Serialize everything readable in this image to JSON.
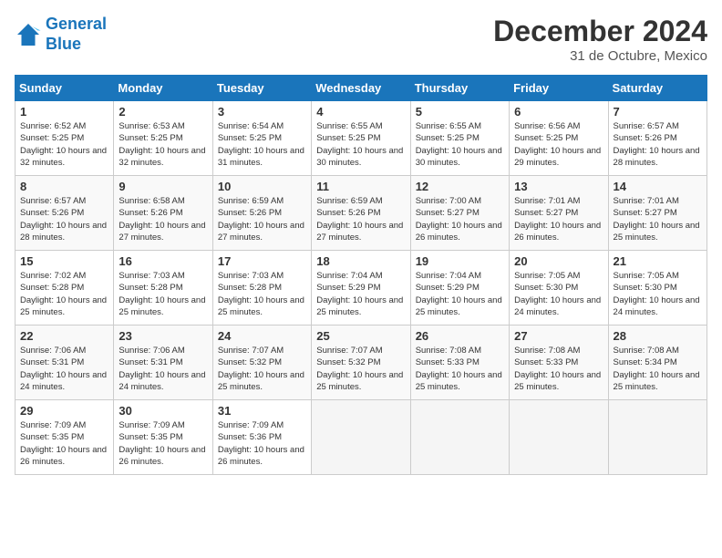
{
  "header": {
    "logo_line1": "General",
    "logo_line2": "Blue",
    "month": "December 2024",
    "location": "31 de Octubre, Mexico"
  },
  "days_of_week": [
    "Sunday",
    "Monday",
    "Tuesday",
    "Wednesday",
    "Thursday",
    "Friday",
    "Saturday"
  ],
  "weeks": [
    [
      {
        "date": "1",
        "sunrise": "6:52 AM",
        "sunset": "5:25 PM",
        "daylight": "10 hours and 32 minutes."
      },
      {
        "date": "2",
        "sunrise": "6:53 AM",
        "sunset": "5:25 PM",
        "daylight": "10 hours and 32 minutes."
      },
      {
        "date": "3",
        "sunrise": "6:54 AM",
        "sunset": "5:25 PM",
        "daylight": "10 hours and 31 minutes."
      },
      {
        "date": "4",
        "sunrise": "6:55 AM",
        "sunset": "5:25 PM",
        "daylight": "10 hours and 30 minutes."
      },
      {
        "date": "5",
        "sunrise": "6:55 AM",
        "sunset": "5:25 PM",
        "daylight": "10 hours and 30 minutes."
      },
      {
        "date": "6",
        "sunrise": "6:56 AM",
        "sunset": "5:25 PM",
        "daylight": "10 hours and 29 minutes."
      },
      {
        "date": "7",
        "sunrise": "6:57 AM",
        "sunset": "5:26 PM",
        "daylight": "10 hours and 28 minutes."
      }
    ],
    [
      {
        "date": "8",
        "sunrise": "6:57 AM",
        "sunset": "5:26 PM",
        "daylight": "10 hours and 28 minutes."
      },
      {
        "date": "9",
        "sunrise": "6:58 AM",
        "sunset": "5:26 PM",
        "daylight": "10 hours and 27 minutes."
      },
      {
        "date": "10",
        "sunrise": "6:59 AM",
        "sunset": "5:26 PM",
        "daylight": "10 hours and 27 minutes."
      },
      {
        "date": "11",
        "sunrise": "6:59 AM",
        "sunset": "5:26 PM",
        "daylight": "10 hours and 27 minutes."
      },
      {
        "date": "12",
        "sunrise": "7:00 AM",
        "sunset": "5:27 PM",
        "daylight": "10 hours and 26 minutes."
      },
      {
        "date": "13",
        "sunrise": "7:01 AM",
        "sunset": "5:27 PM",
        "daylight": "10 hours and 26 minutes."
      },
      {
        "date": "14",
        "sunrise": "7:01 AM",
        "sunset": "5:27 PM",
        "daylight": "10 hours and 25 minutes."
      }
    ],
    [
      {
        "date": "15",
        "sunrise": "7:02 AM",
        "sunset": "5:28 PM",
        "daylight": "10 hours and 25 minutes."
      },
      {
        "date": "16",
        "sunrise": "7:03 AM",
        "sunset": "5:28 PM",
        "daylight": "10 hours and 25 minutes."
      },
      {
        "date": "17",
        "sunrise": "7:03 AM",
        "sunset": "5:28 PM",
        "daylight": "10 hours and 25 minutes."
      },
      {
        "date": "18",
        "sunrise": "7:04 AM",
        "sunset": "5:29 PM",
        "daylight": "10 hours and 25 minutes."
      },
      {
        "date": "19",
        "sunrise": "7:04 AM",
        "sunset": "5:29 PM",
        "daylight": "10 hours and 25 minutes."
      },
      {
        "date": "20",
        "sunrise": "7:05 AM",
        "sunset": "5:30 PM",
        "daylight": "10 hours and 24 minutes."
      },
      {
        "date": "21",
        "sunrise": "7:05 AM",
        "sunset": "5:30 PM",
        "daylight": "10 hours and 24 minutes."
      }
    ],
    [
      {
        "date": "22",
        "sunrise": "7:06 AM",
        "sunset": "5:31 PM",
        "daylight": "10 hours and 24 minutes."
      },
      {
        "date": "23",
        "sunrise": "7:06 AM",
        "sunset": "5:31 PM",
        "daylight": "10 hours and 24 minutes."
      },
      {
        "date": "24",
        "sunrise": "7:07 AM",
        "sunset": "5:32 PM",
        "daylight": "10 hours and 25 minutes."
      },
      {
        "date": "25",
        "sunrise": "7:07 AM",
        "sunset": "5:32 PM",
        "daylight": "10 hours and 25 minutes."
      },
      {
        "date": "26",
        "sunrise": "7:08 AM",
        "sunset": "5:33 PM",
        "daylight": "10 hours and 25 minutes."
      },
      {
        "date": "27",
        "sunrise": "7:08 AM",
        "sunset": "5:33 PM",
        "daylight": "10 hours and 25 minutes."
      },
      {
        "date": "28",
        "sunrise": "7:08 AM",
        "sunset": "5:34 PM",
        "daylight": "10 hours and 25 minutes."
      }
    ],
    [
      {
        "date": "29",
        "sunrise": "7:09 AM",
        "sunset": "5:35 PM",
        "daylight": "10 hours and 26 minutes."
      },
      {
        "date": "30",
        "sunrise": "7:09 AM",
        "sunset": "5:35 PM",
        "daylight": "10 hours and 26 minutes."
      },
      {
        "date": "31",
        "sunrise": "7:09 AM",
        "sunset": "5:36 PM",
        "daylight": "10 hours and 26 minutes."
      },
      null,
      null,
      null,
      null
    ]
  ]
}
